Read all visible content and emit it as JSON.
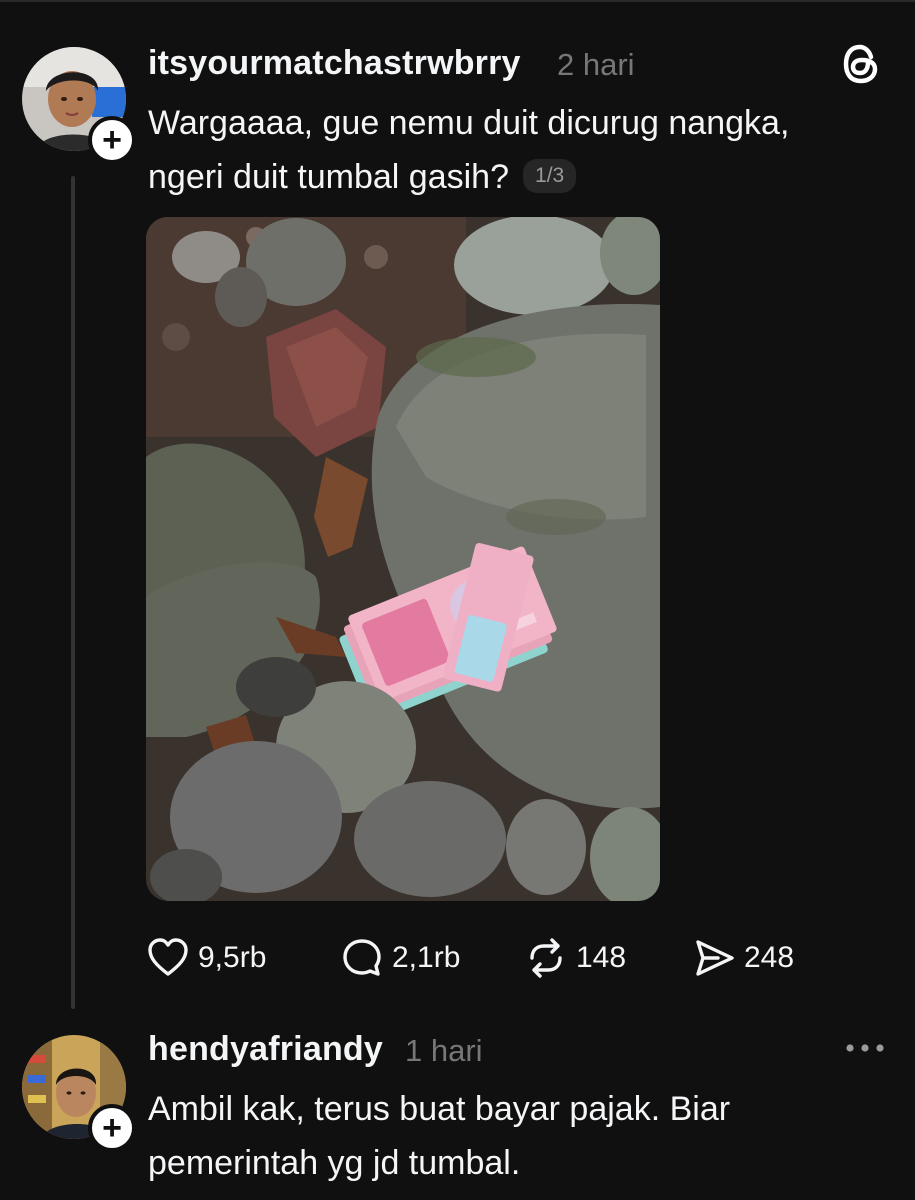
{
  "post": {
    "username": "itsyourmatchastrwbrry",
    "time": "2 hari",
    "text_line1": "Wargaaaa, gue nemu duit dicurug nangka,",
    "text_line2": "ngeri duit tumbal gasih?",
    "image_counter": "1/3",
    "follow_badge": "+",
    "actions": {
      "likes": "9,5rb",
      "comments": "2,1rb",
      "reposts": "148",
      "shares": "248"
    }
  },
  "reply": {
    "username": "hendyafriandy",
    "time": "1 hari",
    "text_line1": "Ambil kak, terus buat bayar pajak. Biar",
    "text_line2": "pemerintah yg jd tumbal.",
    "follow_badge": "+"
  },
  "icons": {
    "app_logo": "threads-logo-icon",
    "like": "heart-icon",
    "comment": "comment-bubble-icon",
    "repost": "repost-icon",
    "share": "send-icon",
    "more": "more-options-icon"
  },
  "colors": {
    "background": "#101010",
    "text_primary": "#f3f5f7",
    "text_secondary": "#777777",
    "thread_line": "#333333"
  }
}
